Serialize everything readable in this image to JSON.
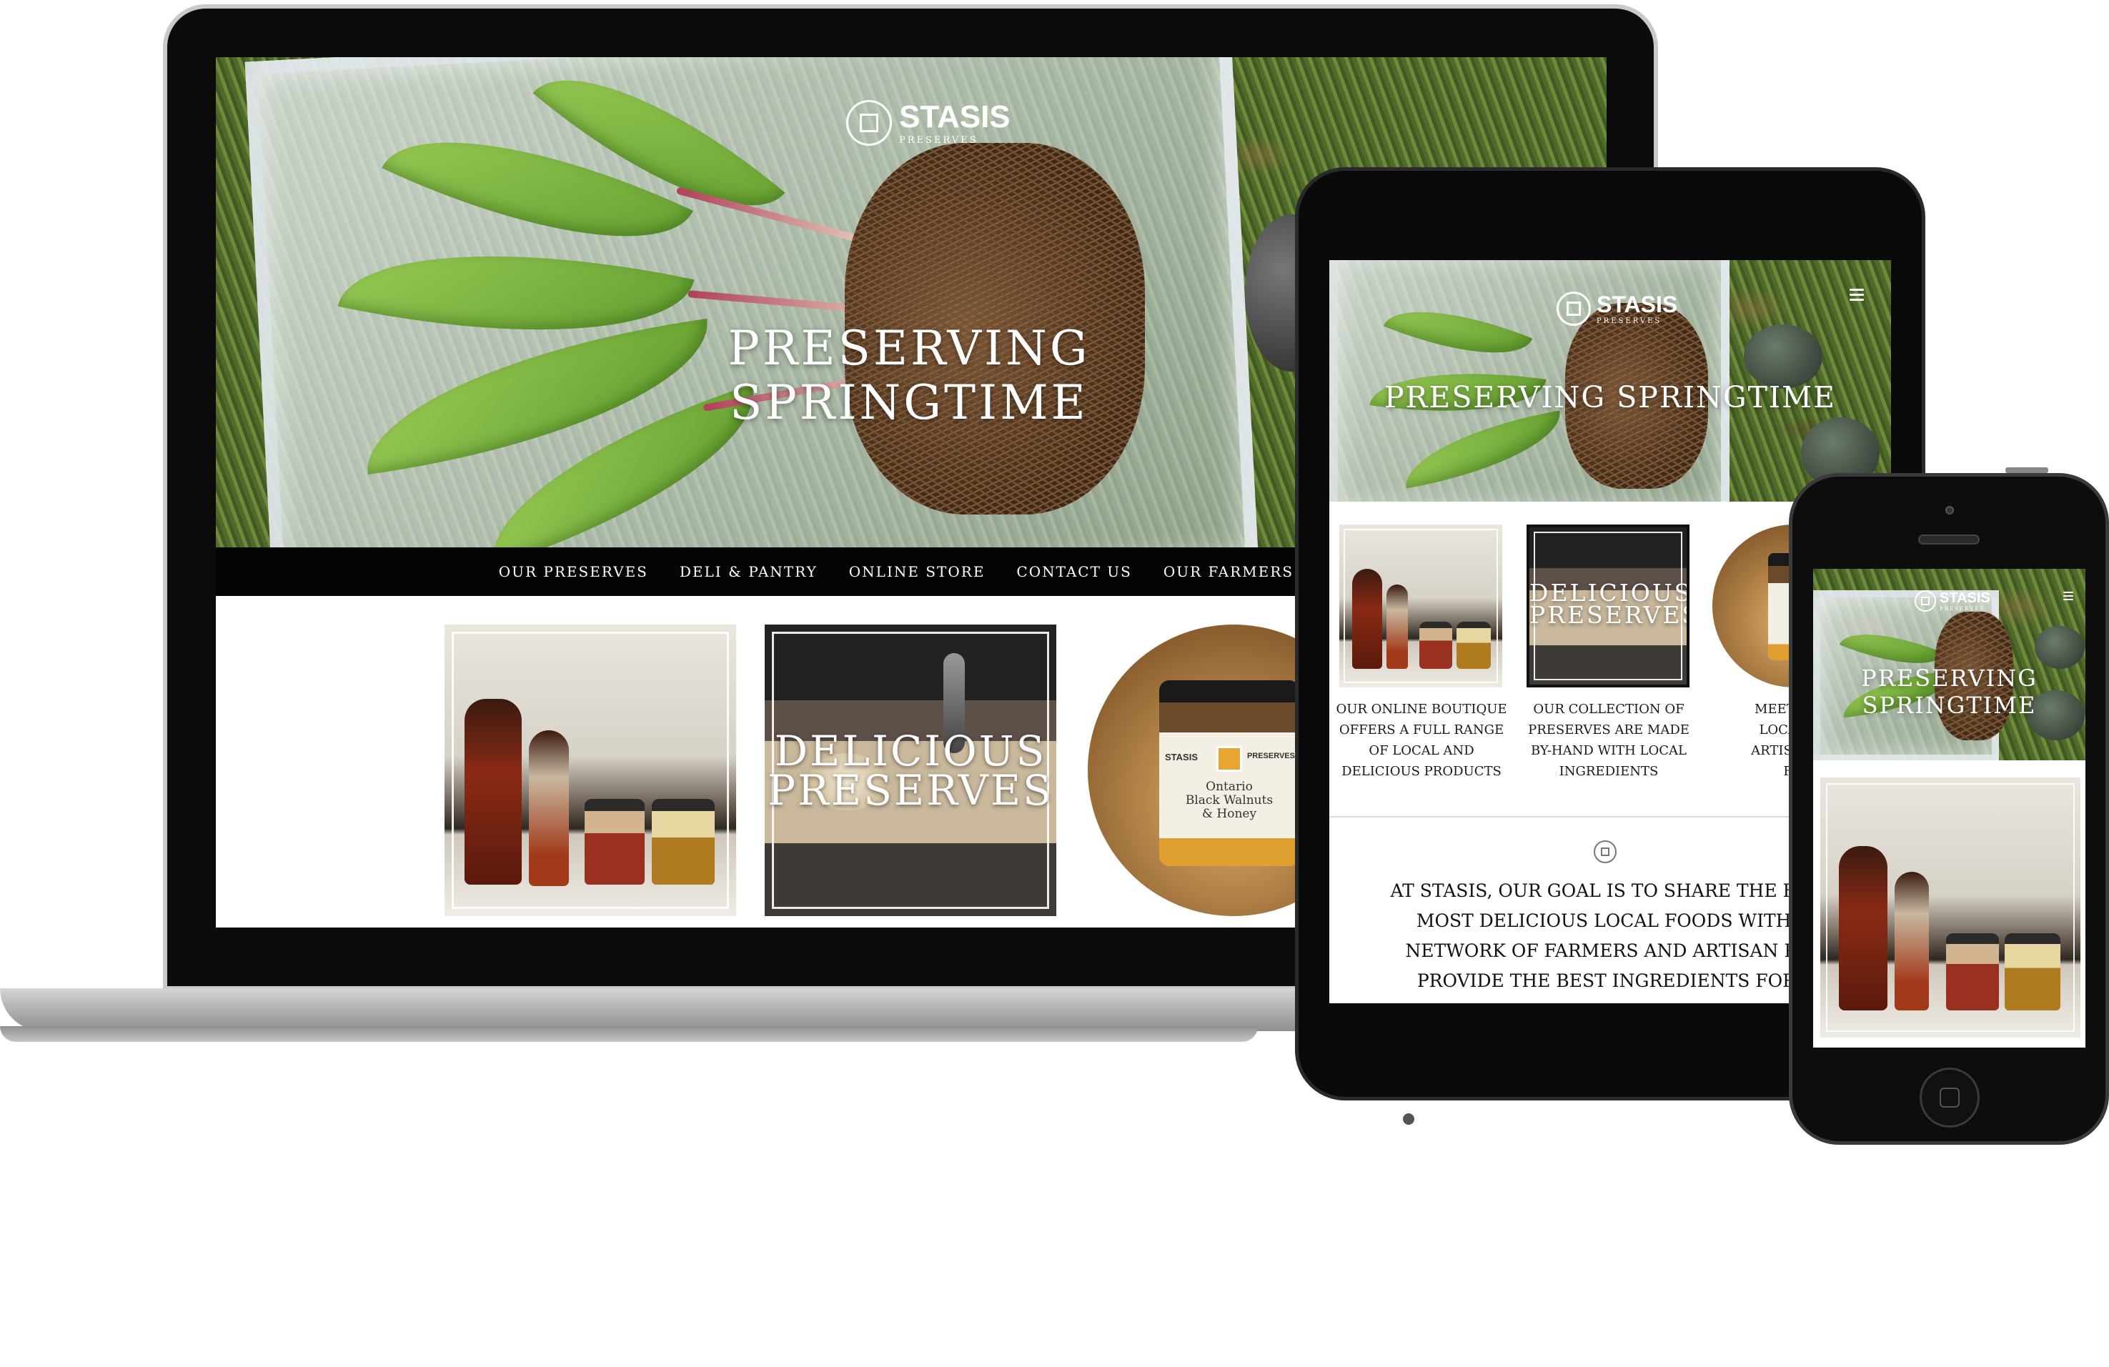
{
  "site": {
    "brand_name": "STASIS",
    "brand_sub": "PRESERVES",
    "hero_title_line1": "PRESERVING",
    "hero_title_line2": "SPRINGTIME",
    "hero_title_single": "PRESERVING SPRINGTIME"
  },
  "nav": {
    "items": [
      "OUR PRESERVES",
      "DELI & PANTRY",
      "ONLINE STORE",
      "CONTACT US",
      "OUR FARMERS & ARTISANS"
    ]
  },
  "tiles": {
    "delicious_line1": "DELICIOUS",
    "delicious_line2": "PRESERVES",
    "jar_label_brand": "STASIS",
    "jar_label_sub": "PRESERVES",
    "jar_label_line1": "Ontario",
    "jar_label_line2": "Black Walnuts",
    "jar_label_line3": "& Honey"
  },
  "blurbs": {
    "boutique": [
      "OUR ONLINE BOUTIQUE",
      "OFFERS A FULL RANGE",
      "OF LOCAL AND",
      "DELICIOUS PRODUCTS"
    ],
    "collection": [
      "OUR COLLECTION OF",
      "PRESERVES ARE MADE",
      "BY-HAND WITH LOCAL",
      "INGREDIENTS"
    ],
    "meet": [
      "MEET SOM",
      "LOCAL FA",
      "ARTISANS B",
      "FO"
    ]
  },
  "goal": {
    "lines": [
      "AT STASIS, OUR GOAL IS TO SHARE THE BEST QU",
      "MOST DELICIOUS LOCAL FOODS WITH YOU.",
      "NETWORK OF FARMERS AND ARTISAN PRODU",
      "PROVIDE THE BEST INGREDIENTS FOR LOC"
    ]
  },
  "phone": {
    "hero_line1": "PRESERVING",
    "hero_line2": "SPRINGTIME"
  }
}
